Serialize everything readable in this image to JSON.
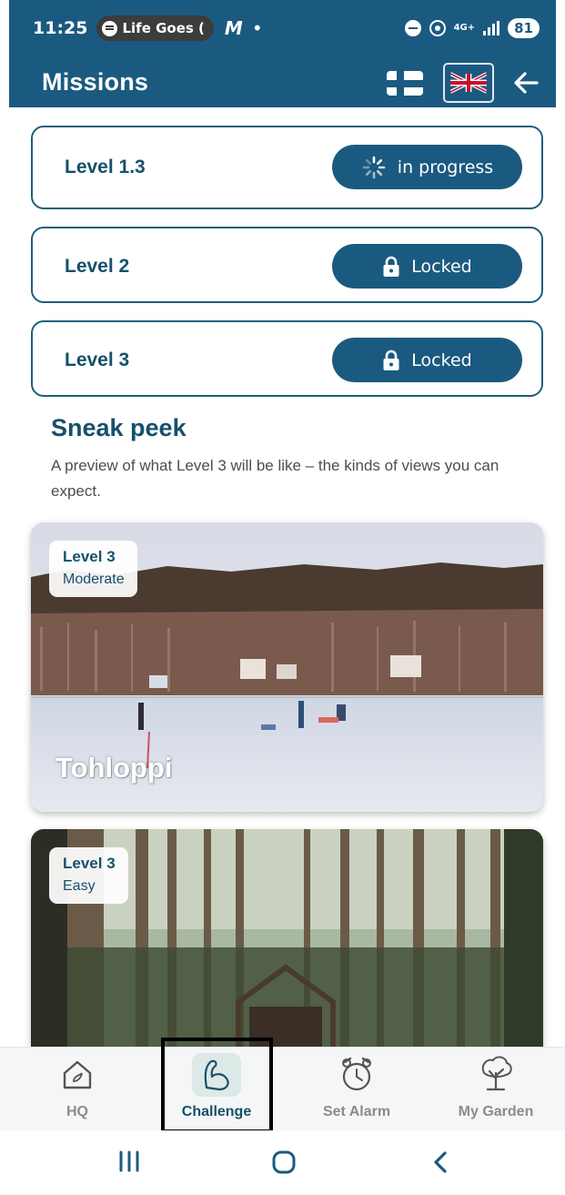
{
  "status_bar": {
    "time": "11:25",
    "media_pill": "Life Goes (",
    "app_letter": "M",
    "bullet": "•",
    "network": "4G+",
    "battery": "81"
  },
  "app_bar": {
    "title": "Missions",
    "icons": [
      "finland-flag-icon",
      "uk-flag-icon",
      "back-arrow-icon"
    ]
  },
  "levels": [
    {
      "label": "Level 1.3",
      "status": "in progress",
      "icon": "loading-spinner-icon"
    },
    {
      "label": "Level 2",
      "status": "Locked",
      "icon": "lock-icon"
    },
    {
      "label": "Level 3",
      "status": "Locked",
      "icon": "lock-icon"
    }
  ],
  "sneak_peek": {
    "title": "Sneak peek",
    "description": "A preview of what Level 3 will be like – the kinds of views you can expect.",
    "views": [
      {
        "level": "Level 3",
        "difficulty": "Moderate",
        "name": "Tohloppi"
      },
      {
        "level": "Level 3",
        "difficulty": "Easy",
        "name": ""
      }
    ]
  },
  "bottom_nav": [
    {
      "label": "HQ",
      "icon": "home-icon"
    },
    {
      "label": "Challenge",
      "icon": "flexed-arm-icon",
      "active": true
    },
    {
      "label": "Set Alarm",
      "icon": "alarm-clock-icon"
    },
    {
      "label": "My Garden",
      "icon": "tree-icon"
    }
  ],
  "colors": {
    "primary": "#1b5a80",
    "text_dark": "#17506b",
    "card_border": "#1e5f7c",
    "nav_inactive": "#8b8b8b"
  }
}
